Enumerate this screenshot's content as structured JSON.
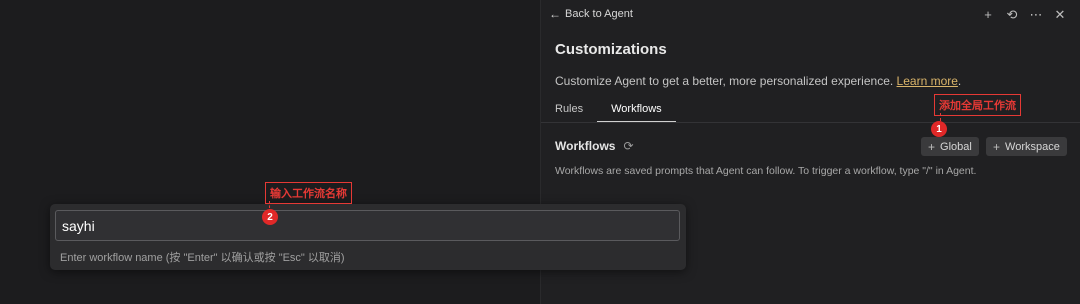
{
  "header": {
    "back_label": "Back to Agent",
    "icons": [
      "plus-icon",
      "history-icon",
      "more-icon",
      "close-icon"
    ]
  },
  "customizations": {
    "title": "Customizations",
    "description": "Customize Agent to get a better, more personalized experience.",
    "learn_more": "Learn more",
    "period": "."
  },
  "tabs": [
    {
      "label": "Rules",
      "active": false
    },
    {
      "label": "Workflows",
      "active": true
    }
  ],
  "workflows": {
    "title": "Workflows",
    "global_label": "Global",
    "workspace_label": "Workspace",
    "description": "Workflows are saved prompts that Agent can follow. To trigger a workflow, type \"/\" in Agent."
  },
  "quick_input": {
    "value": "sayhi",
    "hint": "Enter workflow name (按 \"Enter\" 以确认或按 \"Esc\" 以取消)"
  },
  "annotations": [
    {
      "number": "1",
      "label": "添加全局工作流"
    },
    {
      "number": "2",
      "label": "输入工作流名称"
    }
  ],
  "colors": {
    "background": "#1c1c1e",
    "panel": "#202022",
    "link": "#d9b46a",
    "annotation": "#e53935"
  }
}
